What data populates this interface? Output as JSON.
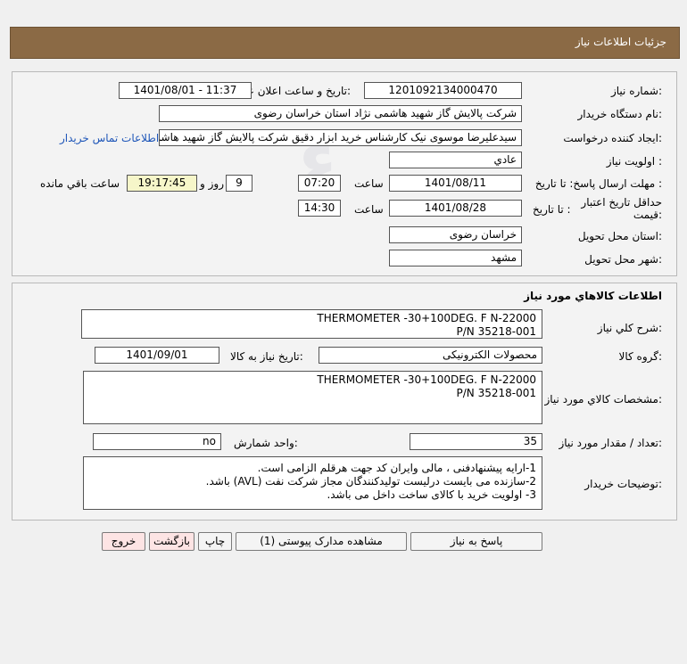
{
  "header": {
    "title": "جزئیات اطلاعات نیاز"
  },
  "info": {
    "need_number_label": "شماره نیاز:",
    "need_number": "1201092134000470",
    "announce_label": "تاریخ و ساعت اعلان عمومی:",
    "announce_value": "1401/08/01 - 11:37",
    "buyer_label": "نام دستگاه خریدار:",
    "buyer_value": "شرکت پالایش گاز شهید هاشمی نژاد   استان خراسان رضوی",
    "creator_label": "ایجاد کننده درخواست:",
    "creator_value": "سیدعلیرضا موسوی نیک کارشناس خرید ابزار دقیق شرکت پالایش گاز شهید هاشمی نژاد",
    "contact_link": "اطلاعات تماس خریدار",
    "priority_label": "اولویت نیاز :",
    "priority_value": "عادي",
    "deadline_label": "مهلت ارسال پاسخ: تا تاریخ :",
    "deadline_date": "1401/08/11",
    "time_label": "ساعت",
    "deadline_time": "07:20",
    "days_value": "9",
    "days_and_label": "روز و",
    "remaining_time": "19:17:45",
    "remaining_label": "ساعت باقي مانده",
    "validity_label_1": "حداقل تاریخ اعتبار",
    "validity_label_2": "قیمت:",
    "validity_to_label": "تا تاریخ :",
    "validity_date": "1401/08/28",
    "validity_time_label": "ساعت",
    "validity_time": "14:30",
    "province_label": "استان محل تحویل:",
    "province_value": "خراسان رضوی",
    "city_label": "شهر محل تحویل:",
    "city_value": "مشهد"
  },
  "goods": {
    "section_title": "اطلاعات کالاهاي مورد نياز",
    "summary_label": "شرح کلي نياز:",
    "summary_value": "THERMOMETER -30+100DEG. F N-22000\nP/N 35218-001",
    "group_label": "گروه کالا:",
    "group_value": "محصولات الکترونیکی",
    "need_date_label": "تاریخ نیاز به کالا:",
    "need_date_value": "1401/09/01",
    "specs_label": "مشخصات کالاي مورد نياز:",
    "specs_value": "THERMOMETER -30+100DEG. F N-22000\nP/N 35218-001",
    "qty_label": "تعداد / مقدار مورد نیاز:",
    "qty_value": "35",
    "unit_label": "واحد شمارش:",
    "unit_value": "no",
    "desc_label": "توضیحات خریدار:",
    "desc_value": "1-ارایه پیشنهادفنی ، مالی وایران کد جهت هرقلم الزامی است.\n2-سازنده می بایست درلیست تولیدکنندگان مجاز شرکت نفت (AVL)  باشد.\n3- اولویت خرید  با کالای ساخت  داخل می باشد."
  },
  "buttons": {
    "reply": "پاسخ به نیاز",
    "attachments": "مشاهده مدارک پیوستی (1)",
    "print": "چاپ",
    "back": "بازگشت",
    "exit": "خروج"
  }
}
